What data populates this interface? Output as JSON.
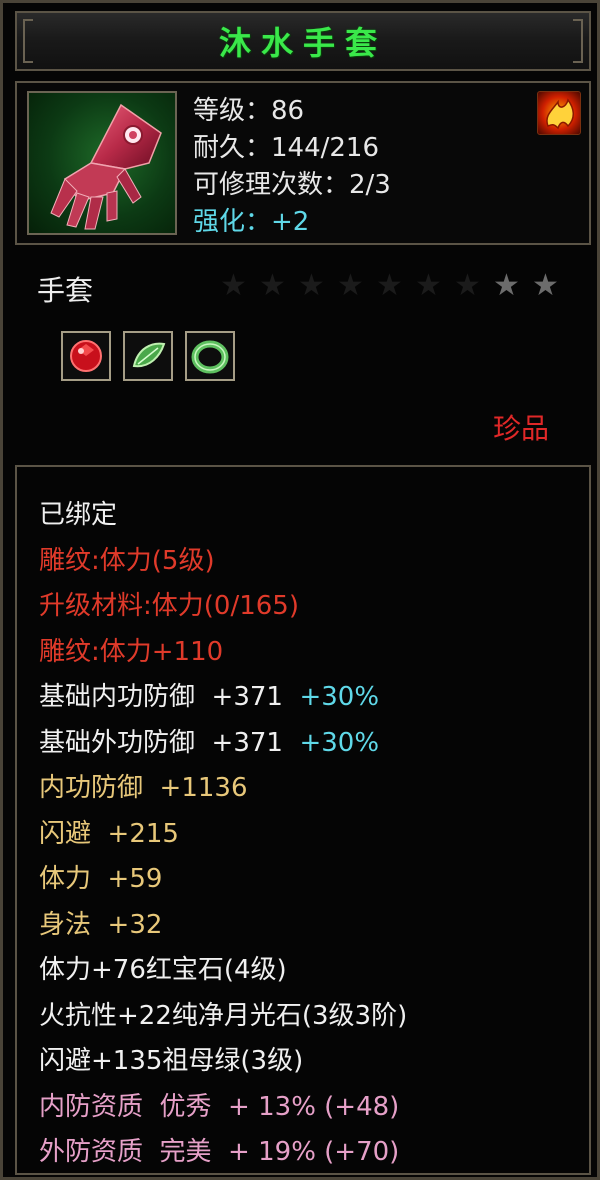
{
  "title": "沐水手套",
  "info": {
    "level": "等级：86",
    "durability": "耐久：144/216",
    "repairs": "可修理次数：2/3",
    "enhance": "强化：+2"
  },
  "item_type": "手套",
  "stars": {
    "total": 9,
    "lit": 2
  },
  "rarity": "珍品",
  "attributes": {
    "bound": "已绑定",
    "carving": "雕纹:体力(5级)",
    "upgrade_material": "升级材料:体力(0/165)",
    "carving_bonus": "雕纹:体力+110",
    "base_inner_def": "基础内功防御  +371",
    "base_inner_def_pct": "+30%",
    "base_outer_def": "基础外功防御  +371",
    "base_outer_def_pct": "+30%",
    "inner_def": "内功防御  +1136",
    "dodge": "闪避  +215",
    "stamina": "体力  +59",
    "agility": "身法  +32",
    "gem1": "体力+76红宝石(4级)",
    "gem2": "火抗性+22纯净月光石(3级3阶)",
    "gem3": "闪避+135祖母绿(3级)",
    "inner_quality": "内防资质  优秀  + 13% (+48)",
    "outer_quality": "外防资质  完美  + 19% (+70)"
  },
  "icons": {
    "item": "gauntlet-icon",
    "element": "fire-icon",
    "gems": [
      "ruby-gem-icon",
      "green-leaf-gem-icon",
      "jade-ring-gem-icon"
    ]
  },
  "colors": {
    "title": "#3ae84a",
    "enhance": "#5fd8e8",
    "rarity": "#e02828",
    "carving": "#e03a2a",
    "attribute": "#e8c87a",
    "quality": "#e6a0c8"
  }
}
